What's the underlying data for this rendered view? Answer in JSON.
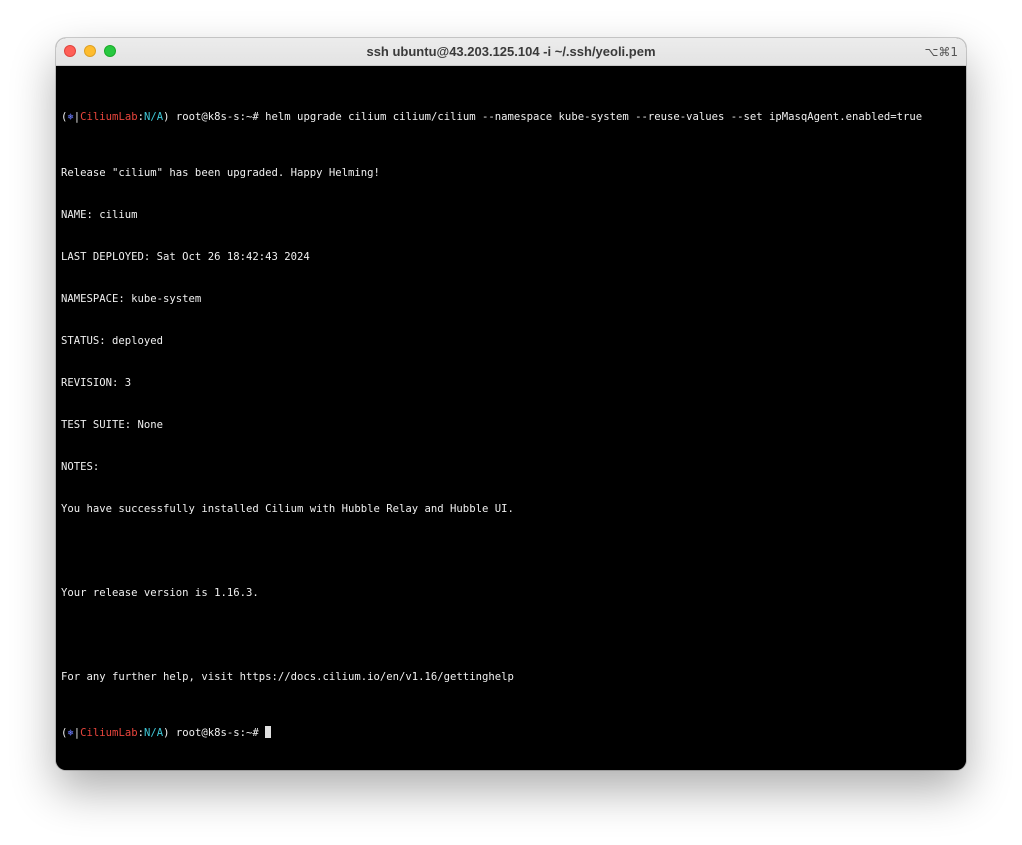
{
  "window": {
    "title": "ssh ubuntu@43.203.125.104 -i ~/.ssh/yeoli.pem",
    "shortcut": "⌥⌘1"
  },
  "colors": {
    "prompt_symbol": "#6c7bff",
    "prompt_context": "#e8453c",
    "prompt_namespace": "#3fc8d8",
    "terminal_bg": "#000000",
    "terminal_fg": "#f0f0f0"
  },
  "prompt": {
    "open": "(",
    "symbol": "⎈",
    "bar": "|",
    "context": "CiliumLab",
    "colon": ":",
    "namespace": "N/A",
    "close": ")",
    "user": " root@k8s-s:~# "
  },
  "command": "helm upgrade cilium cilium/cilium --namespace kube-system --reuse-values --set ipMasqAgent.enabled=true",
  "output": [
    "Release \"cilium\" has been upgraded. Happy Helming!",
    "NAME: cilium",
    "LAST DEPLOYED: Sat Oct 26 18:42:43 2024",
    "NAMESPACE: kube-system",
    "STATUS: deployed",
    "REVISION: 3",
    "TEST SUITE: None",
    "NOTES:",
    "You have successfully installed Cilium with Hubble Relay and Hubble UI.",
    "",
    "Your release version is 1.16.3.",
    "",
    "For any further help, visit https://docs.cilium.io/en/v1.16/gettinghelp"
  ]
}
